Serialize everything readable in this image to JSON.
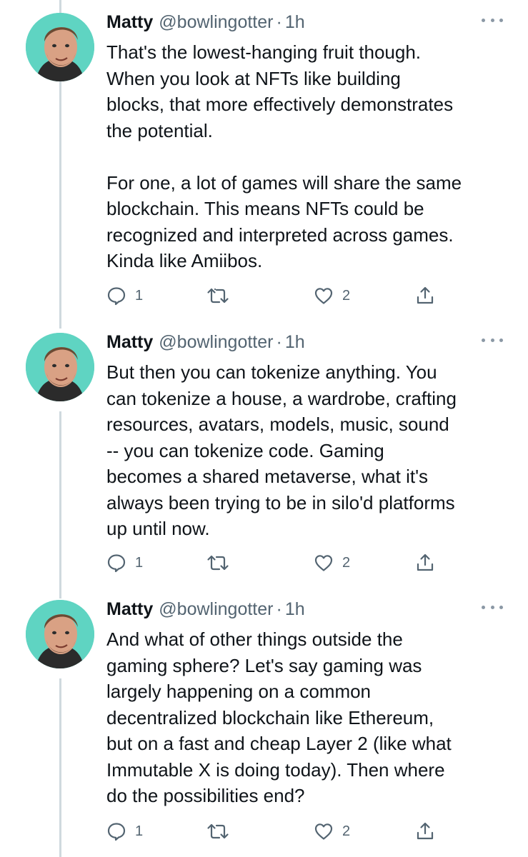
{
  "tweets": [
    {
      "name": "Matty",
      "handle": "@bowlingotter",
      "separator": "·",
      "time": "1h",
      "text": "That's the lowest-hanging fruit though.\nWhen you look at NFTs like building\nblocks, that more effectively demonstrates\nthe potential.\n\nFor one, a lot of games will share the same\nblockchain. This means NFTs could be\nrecognized and interpreted across games.\nKinda like Amiibos.",
      "replies": "1",
      "retweets": "",
      "likes": "2"
    },
    {
      "name": "Matty",
      "handle": "@bowlingotter",
      "separator": "·",
      "time": "1h",
      "text": "But then you can tokenize anything. You\ncan tokenize a house, a wardrobe, crafting\nresources, avatars, models, music, sound\n-- you can tokenize code. Gaming\nbecomes a shared metaverse, what it's\nalways been trying to be in silo'd platforms\nup until now.",
      "replies": "1",
      "retweets": "",
      "likes": "2"
    },
    {
      "name": "Matty",
      "handle": "@bowlingotter",
      "separator": "·",
      "time": "1h",
      "text": "And what of other things outside the\ngaming sphere? Let's say gaming was\nlargely happening on a common\ndecentralized blockchain like Ethereum,\nbut on a fast and cheap Layer 2 (like what\nImmutable X is doing today). Then where\ndo the possibilities end?",
      "replies": "1",
      "retweets": "",
      "likes": "2"
    }
  ],
  "colors": {
    "avatar_background": "#5fd4c2",
    "secondary_text": "#536471",
    "thread_line": "#cfd9de"
  },
  "icons": [
    "avatar",
    "more-icon",
    "reply-icon",
    "retweet-icon",
    "like-icon",
    "share-icon"
  ]
}
